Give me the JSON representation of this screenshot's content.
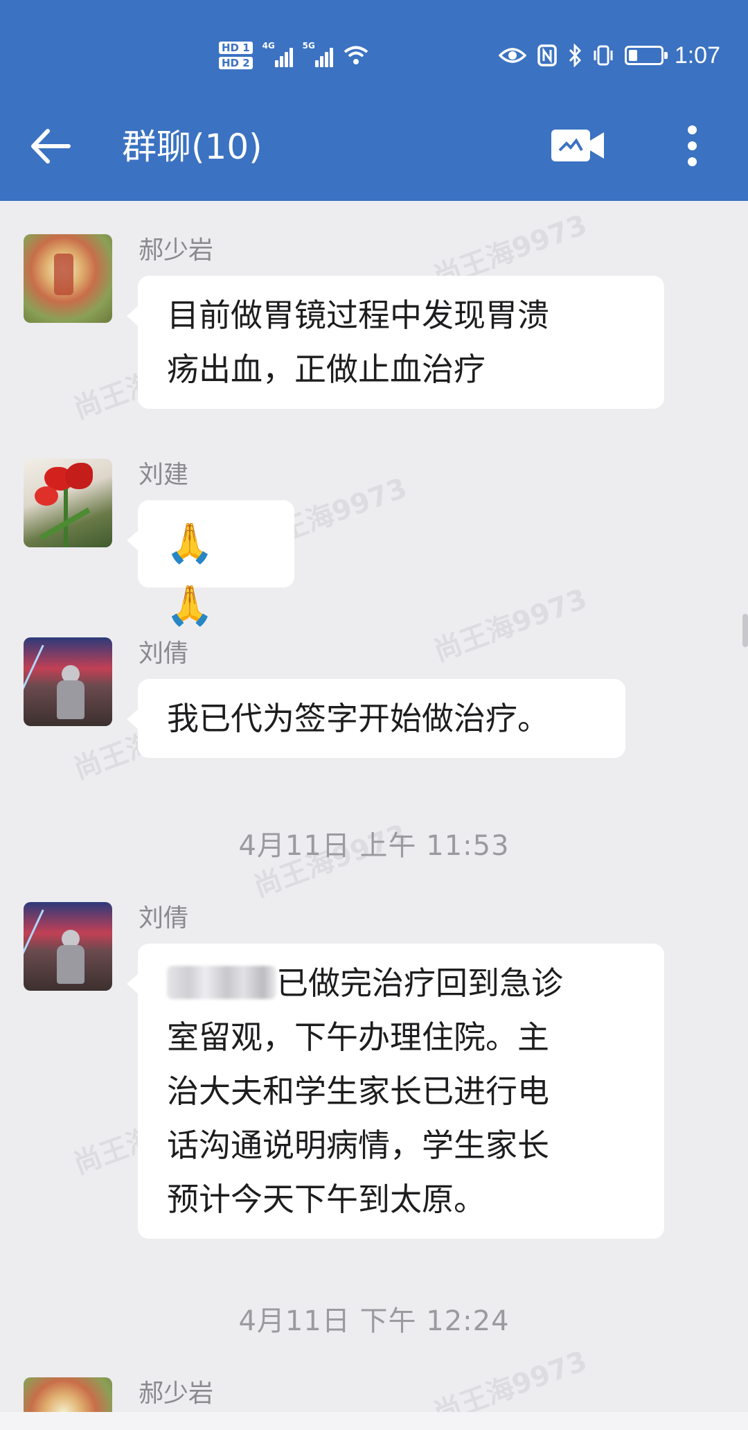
{
  "status_bar": {
    "hd1": "HD 1",
    "hd2": "HD 2",
    "net1": "4G",
    "net2": "5G",
    "time": "1:07"
  },
  "header": {
    "title": "群聊(10)",
    "background": "#3b72c2"
  },
  "icons": {
    "back": "arrow-left-icon",
    "video": "video-camera-icon",
    "more": "more-vertical-icon"
  },
  "watermark_text": "尚王海9973",
  "messages": [
    {
      "sender": "郝少岩",
      "lines": [
        "目前做胃镜过程中发现胃溃",
        "疡出血，正做止血治疗"
      ]
    },
    {
      "sender": "刘建",
      "lines": [
        "🙏🙏"
      ]
    },
    {
      "sender": "刘倩",
      "lines": [
        "我已代为签字开始做治疗。"
      ]
    },
    {
      "sender": "刘倩",
      "lines": [
        "已做完治疗回到急诊",
        "室留观，下午办理住院。主",
        "治大夫和学生家长已进行电",
        "话沟通说明病情，学生家长",
        "预计今天下午到太原。"
      ]
    },
    {
      "sender": "郝少岩",
      "lines": []
    }
  ],
  "timestamps": [
    "4月11日 上午 11:53",
    "4月11日 下午 12:24"
  ]
}
